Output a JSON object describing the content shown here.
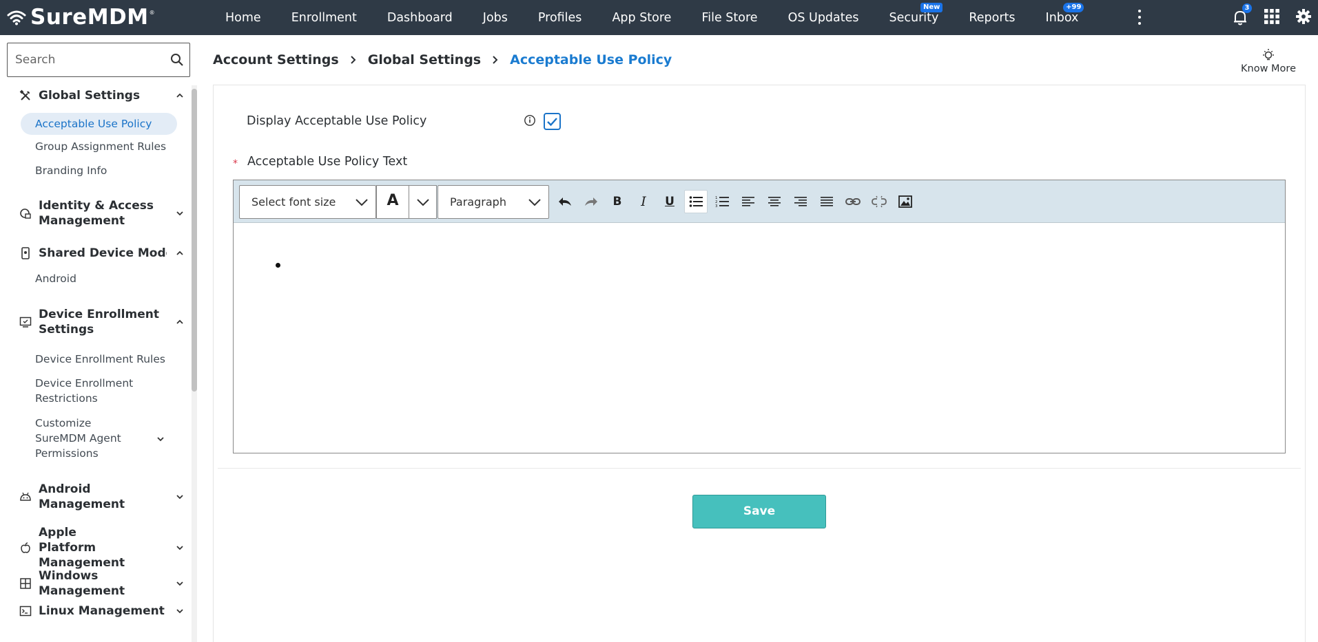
{
  "app": {
    "brand": "SureMDM",
    "brand_mark": "®"
  },
  "nav": {
    "items": [
      {
        "label": "Home"
      },
      {
        "label": "Enrollment"
      },
      {
        "label": "Dashboard"
      },
      {
        "label": "Jobs"
      },
      {
        "label": "Profiles"
      },
      {
        "label": "App Store"
      },
      {
        "label": "File Store"
      },
      {
        "label": "OS Updates"
      },
      {
        "label": "Security",
        "badge": "New"
      },
      {
        "label": "Reports"
      },
      {
        "label": "Inbox",
        "badge": "+99"
      }
    ],
    "notification_count": "3",
    "icons": [
      "more-vertical-icon",
      "bell-icon",
      "apps-grid-icon",
      "gear-icon"
    ]
  },
  "sidebar": {
    "search_placeholder": "Search",
    "groups": {
      "global": {
        "label": "Global Settings",
        "icon": "tools-icon",
        "expanded": true,
        "items": [
          "Acceptable Use Policy",
          "Group Assignment Rules",
          "Branding Info"
        ]
      },
      "identity": {
        "label": "Identity & Access Management",
        "icon": "lock-icon",
        "expanded": false
      },
      "shared": {
        "label": "Shared Device Mode",
        "icon": "phone-icon",
        "expanded": true,
        "items": [
          "Android"
        ]
      },
      "enrollment": {
        "label": "Device Enrollment Settings",
        "icon": "monitor-icon",
        "expanded": true,
        "items": [
          "Device Enrollment Rules",
          "Device Enrollment Restrictions",
          "Customize SureMDM Agent Permissions"
        ]
      },
      "android": {
        "label": "Android Management",
        "icon": "android-icon",
        "expanded": false
      },
      "apple": {
        "label": "Apple Platform Management",
        "icon": "apple-icon",
        "expanded": false
      },
      "windows": {
        "label": "Windows Management",
        "icon": "windows-icon",
        "expanded": false
      },
      "linux": {
        "label": "Linux Management",
        "icon": "terminal-icon",
        "expanded": false
      }
    }
  },
  "breadcrumb": {
    "items": [
      "Account Settings",
      "Global Settings"
    ],
    "current": "Acceptable Use Policy"
  },
  "know_more": "Know More",
  "form": {
    "display_label": "Display Acceptable Use Policy",
    "display_checked": true,
    "text_label": "Acceptable Use Policy Text",
    "required_mark": "*",
    "editor": {
      "font_size_placeholder": "Select font size",
      "font_color_glyph": "A",
      "block_format": "Paragraph",
      "tools": [
        "undo",
        "redo",
        "bold",
        "italic",
        "underline",
        "bullet-list",
        "numbered-list",
        "align-left",
        "align-center",
        "align-right",
        "justify",
        "link",
        "unlink",
        "image"
      ],
      "active_tool": "bullet-list",
      "bold_glyph": "B",
      "italic_glyph": "I",
      "underline_glyph": "U",
      "content": ""
    },
    "save_label": "Save"
  },
  "colors": {
    "topbar": "#2f3a46",
    "accent": "#1a7bd0",
    "save": "#46c0bd",
    "badge": "#1a73e8",
    "toolbar": "#d7e4ec"
  }
}
